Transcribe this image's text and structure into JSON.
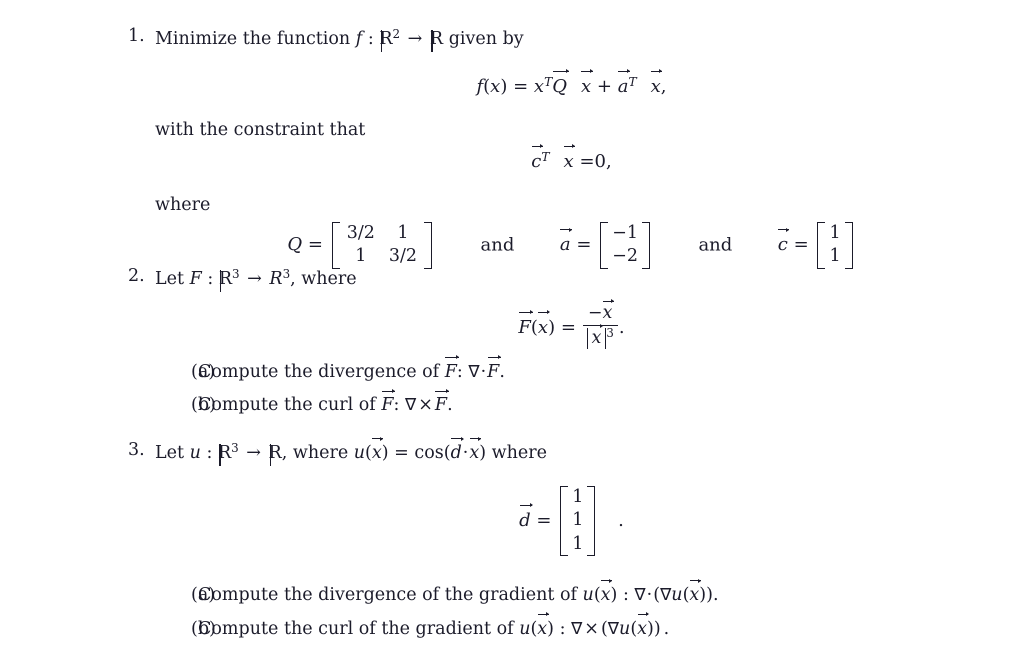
{
  "document": {
    "type": "math-homework-problem-set",
    "background_color": "#ffffff",
    "text_color": "#1b1b2a"
  },
  "problems": [
    {
      "number": "1.",
      "stem": "Minimize the function",
      "function_name": "f",
      "colon": ":",
      "domain": "R",
      "domain_exp": "2",
      "arrow": "→",
      "codomain": "R",
      "stem_tail": "given by",
      "equation": {
        "lhs_f": "f",
        "lhs_paren_open": "(",
        "lhs_var": "x",
        "lhs_paren_close": ")",
        "equals": "=",
        "term1_x": "x",
        "term1_T": "T",
        "term1_Q": "Q",
        "term1_xvec": "x",
        "plus": "+",
        "term2_a": "a",
        "term2_T": "T",
        "term2_xvec": "x",
        "comma": ","
      },
      "constraint_intro": "with the constraint that",
      "constraint": {
        "c": "c",
        "T": "T",
        "x": "x",
        "equals": "=",
        "value": "0",
        "comma": ","
      },
      "where_label": "where",
      "definitions": {
        "Q_label": "Q",
        "Q_equals": "=",
        "Q_rows": [
          [
            "3/2",
            "1"
          ],
          [
            "1",
            "3/2"
          ]
        ],
        "and_1": "and",
        "a_label": "a",
        "a_equals": "=",
        "a_rows": [
          [
            "−1"
          ],
          [
            "−2"
          ]
        ],
        "and_2": "and",
        "c_label": "c",
        "c_equals": "=",
        "c_rows": [
          [
            "1"
          ],
          [
            "1"
          ]
        ]
      }
    },
    {
      "number": "2.",
      "stem_let": "Let",
      "function_name": "F",
      "colon": ":",
      "domain": "R",
      "domain_exp": "3",
      "arrow": "→",
      "codomain": "R",
      "codomain_exp": "3",
      "stem_tail": ", where",
      "equation": {
        "F": "F",
        "paren_open": "(",
        "arg": "x",
        "paren_close": ")",
        "equals": "=",
        "numerator_minus": "−",
        "numerator_var": "x",
        "denominator_var": "x",
        "denominator_exp": "3",
        "period": "."
      },
      "subitems": [
        {
          "label": "(a)",
          "text_before": "Compute the divergence of",
          "symbol": "F",
          "colon": ":",
          "nabla": "∇",
          "operator": "·",
          "symbol2": "F",
          "period": "."
        },
        {
          "label": "(b)",
          "text_before": "Compute the curl of",
          "symbol": "F",
          "colon": ":",
          "nabla": "∇",
          "operator": "×",
          "symbol2": "F",
          "period": "."
        }
      ]
    },
    {
      "number": "3.",
      "stem_let": "Let",
      "function_name": "u",
      "colon": ":",
      "domain": "R",
      "domain_exp": "3",
      "arrow": "→",
      "codomain": "R",
      "stem_mid": ", where",
      "def_u": "u",
      "def_paren_open": "(",
      "def_arg": "x",
      "def_paren_close": ")",
      "def_equals": "=",
      "def_cos": "cos",
      "def_cos_open": "(",
      "def_d": "d",
      "def_dot": "·",
      "def_x": "x",
      "def_cos_close": ")",
      "stem_tail": "where",
      "d_definition": {
        "label": "d",
        "equals": "=",
        "rows": [
          [
            "1"
          ],
          [
            "1"
          ],
          [
            "1"
          ]
        ],
        "period": "."
      },
      "subitems": [
        {
          "label": "(a)",
          "text_before": "Compute the divergence of the gradient of",
          "u": "u",
          "paren_open": "(",
          "arg": "x",
          "paren_close": ")",
          "colon": ":",
          "nabla": "∇",
          "operator": "·",
          "group_open": "(",
          "nabla2": "∇",
          "u2": "u",
          "paren_open2": "(",
          "arg2": "x",
          "paren_close2": ")",
          "group_close": ")",
          "period": "."
        },
        {
          "label": "(b)",
          "text_before": "Compute the curl of the gradient of",
          "u": "u",
          "paren_open": "(",
          "arg": "x",
          "paren_close": ")",
          "colon": ":",
          "nabla": "∇",
          "operator": "×",
          "group_open": "(",
          "nabla2": "∇",
          "u2": "u",
          "paren_open2": "(",
          "arg2": "x",
          "paren_close2": ")",
          "group_close": ")",
          "period": "."
        }
      ]
    }
  ]
}
